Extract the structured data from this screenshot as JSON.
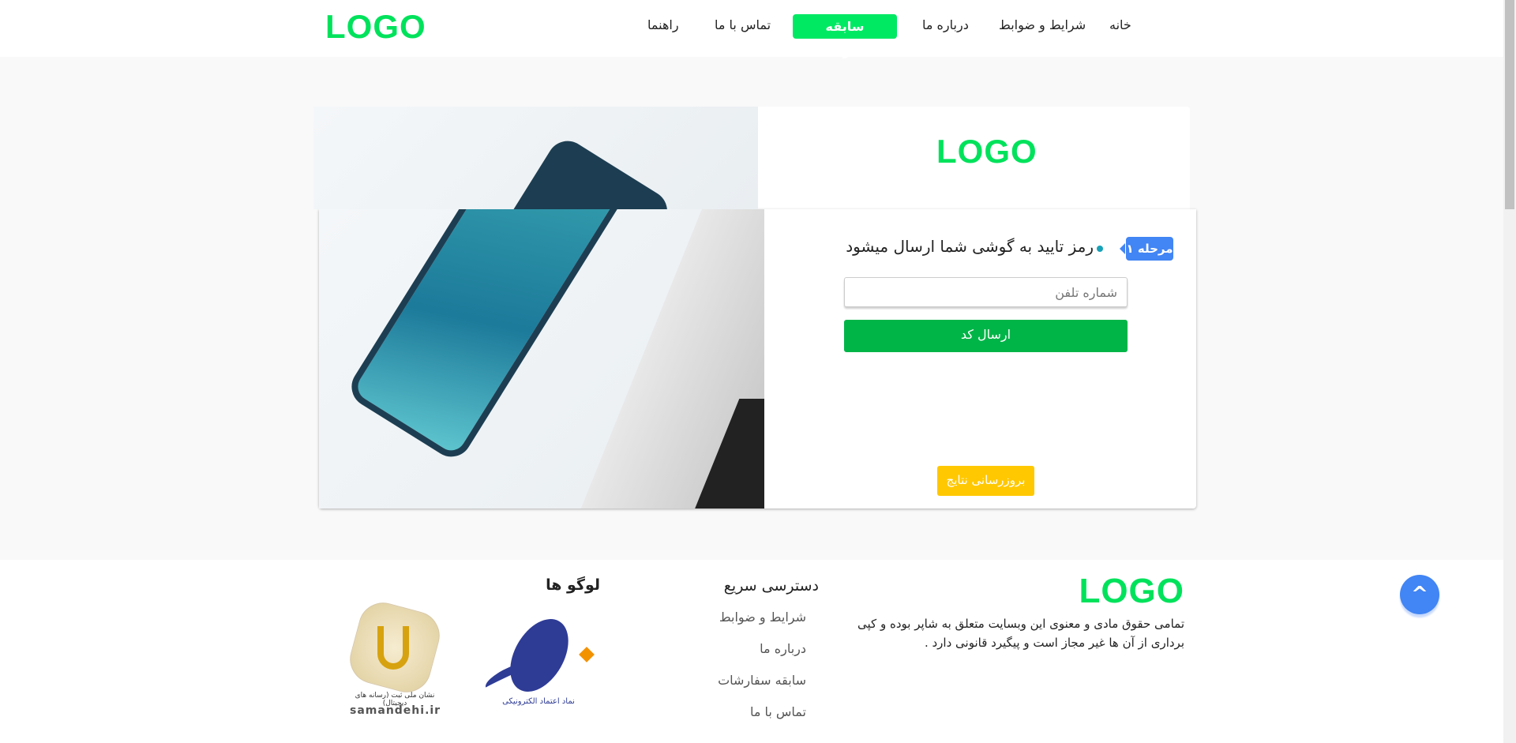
{
  "header": {
    "logo": "LOGO",
    "nav": [
      {
        "label": "خانه"
      },
      {
        "label": "شرایط و ضوابط"
      },
      {
        "label": "درباره ما"
      },
      {
        "label": "سابقه سفارشات",
        "active": true
      },
      {
        "label": "تماس با ما"
      },
      {
        "label": "راهنما"
      }
    ]
  },
  "card": {
    "logo": "LOGO",
    "step_badge": "مرحله ۱",
    "step_text": "رمز تایید به گوشی شما ارسال میشود",
    "phone_placeholder": "شماره تلفن",
    "send_button": "ارسال کد",
    "refresh_button": "بروزرسانی نتایج"
  },
  "footer": {
    "logo": "LOGO",
    "copyright": "تمامی حقوق مادی و معنوی این وبسایت متعلق به شاپر بوده و کپی برداری از آن ها غیر مجاز است و پیگیرد قانونی دارد .",
    "quick_access": {
      "title": "دسترسی سریع",
      "links": [
        "شرایط و ضوابط",
        "درباره ما",
        "سابقه سفارشات",
        "تماس با ما"
      ]
    },
    "logos": {
      "title": "لوگو ها",
      "enamad_caption": "نماد اعتماد الکترونیکی",
      "samandehi_caption": "نشان ملی ثبت (رسانه های دیجیتال)",
      "samandehi_url": "samandehi.ir"
    }
  },
  "colors": {
    "brand": "#00e25b",
    "primary": "#00b548",
    "accent": "#4285f4",
    "warning": "#ffc800"
  }
}
